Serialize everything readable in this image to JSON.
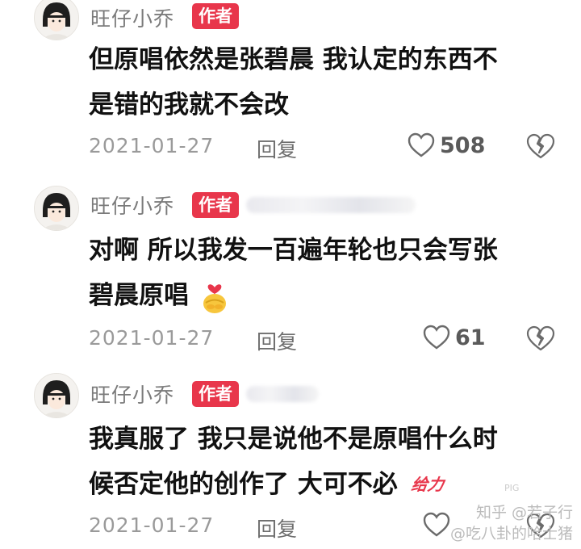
{
  "comments": [
    {
      "author": "旺仔小乔",
      "badge": "作者",
      "line1": "但原唱依然是张碧晨 我认定的东西不",
      "line2": "是错的我就不会改",
      "date": "2021-01-27",
      "reply_label": "回复",
      "likes": "508"
    },
    {
      "author": "旺仔小乔",
      "badge": "作者",
      "line1": "对啊 所以我发一百遍年轮也只会写张",
      "line2": "碧晨原唱",
      "date": "2021-01-27",
      "reply_label": "回复",
      "likes": "61"
    },
    {
      "author": "旺仔小乔",
      "badge": "作者",
      "line1": "我真服了 我只是说他不是原唱什么时",
      "line2": "候否定他的创作了 大可不必",
      "sticker_text": "给力",
      "date": "2021-01-27",
      "reply_label": "回复",
      "likes": ""
    }
  ],
  "watermark": {
    "line1": "知乎 @若子行",
    "line2": "@吃八卦的哈士猪",
    "corner": "PIG"
  },
  "icons": {
    "like": "heart-outline-icon",
    "dislike": "broken-heart-icon",
    "emoji": "hug-emoji-icon"
  },
  "colors": {
    "badge": "#e8364b",
    "meta_text": "#9a9a9a",
    "body_text": "#111111"
  }
}
